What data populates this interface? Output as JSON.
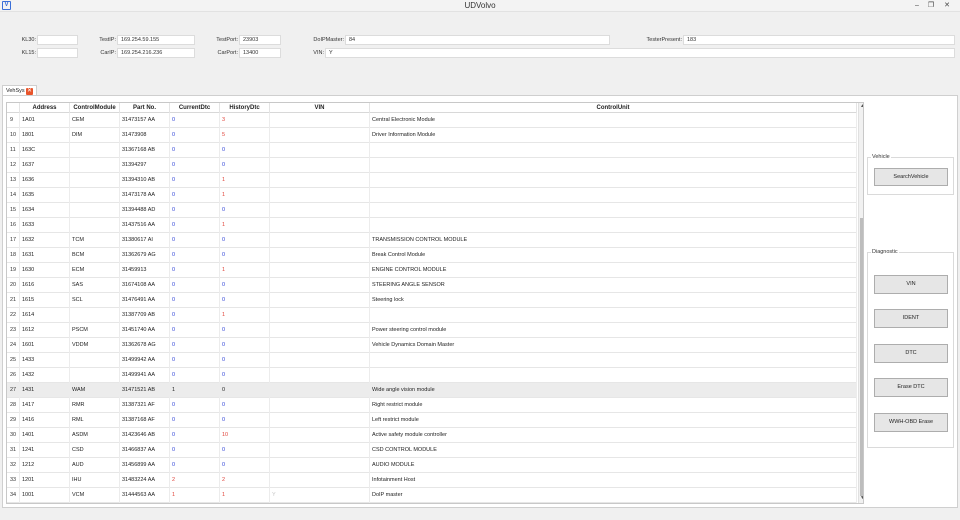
{
  "window": {
    "title": "UDVolvo",
    "app_icon": "V",
    "minimize_glyph": "–",
    "restore_glyph": "❐",
    "close_glyph": "✕"
  },
  "fields": {
    "kl30": {
      "label": "KL30:",
      "value": ""
    },
    "kl15": {
      "label": "KL15:",
      "value": ""
    },
    "test_ip": {
      "label": "TestIP:",
      "value": "169.254.59.155"
    },
    "car_ip": {
      "label": "CarIP:",
      "value": "169.254.216.236"
    },
    "test_port": {
      "label": "TestPort:",
      "value": "23903"
    },
    "car_port": {
      "label": "CarPort:",
      "value": "13400"
    },
    "doip_master": {
      "label": "DoIPMaster:",
      "value": "84"
    },
    "vin": {
      "label": "VIN:",
      "value": "Y"
    },
    "tester_present": {
      "label": "TesterPresent:",
      "value": "183"
    }
  },
  "tab": {
    "label": "VehSys",
    "close_glyph": "✕"
  },
  "grid": {
    "columns": {
      "address": "Address",
      "module": "ControlModule",
      "part": "Part No.",
      "current_dtc": "CurrentDtc",
      "history_dtc": "HistoryDtc",
      "vin": "VIN",
      "unit": "ControlUnit"
    },
    "rows": [
      {
        "n": "9",
        "address": "1A01",
        "module": "CEM",
        "part": "31473157 AA",
        "current": "0",
        "history": "3",
        "vin": "",
        "unit": "Central Electronic Module"
      },
      {
        "n": "10",
        "address": "1801",
        "module": "DIM",
        "part": "31473908",
        "current": "0",
        "history": "5",
        "vin": "",
        "unit": "Driver Information Module"
      },
      {
        "n": "11",
        "address": "163C",
        "module": "",
        "part": "31367168 AB",
        "current": "0",
        "history": "0",
        "vin": "",
        "unit": ""
      },
      {
        "n": "12",
        "address": "1637",
        "module": "",
        "part": "31394297",
        "current": "0",
        "history": "0",
        "vin": "",
        "unit": ""
      },
      {
        "n": "13",
        "address": "1636",
        "module": "",
        "part": "31394310 AB",
        "current": "0",
        "history": "1",
        "vin": "",
        "unit": ""
      },
      {
        "n": "14",
        "address": "1635",
        "module": "",
        "part": "31473178 AA",
        "current": "0",
        "history": "1",
        "vin": "",
        "unit": ""
      },
      {
        "n": "15",
        "address": "1634",
        "module": "",
        "part": "31394488 AD",
        "current": "0",
        "history": "0",
        "vin": "",
        "unit": ""
      },
      {
        "n": "16",
        "address": "1633",
        "module": "",
        "part": "31437516 AA",
        "current": "0",
        "history": "1",
        "vin": "",
        "unit": ""
      },
      {
        "n": "17",
        "address": "1632",
        "module": "TCM",
        "part": "31380617 AI",
        "current": "0",
        "history": "0",
        "vin": "",
        "unit": "TRANSMISSION CONTROL MODULE"
      },
      {
        "n": "18",
        "address": "1631",
        "module": "BCM",
        "part": "31362679 AG",
        "current": "0",
        "history": "0",
        "vin": "",
        "unit": "Break Control Module"
      },
      {
        "n": "19",
        "address": "1630",
        "module": "ECM",
        "part": "31459913",
        "current": "0",
        "history": "1",
        "vin": "",
        "unit": "ENGINE CONTROL MODULE"
      },
      {
        "n": "20",
        "address": "1616",
        "module": "SAS",
        "part": "31674108 AA",
        "current": "0",
        "history": "0",
        "vin": "",
        "unit": "STEERING ANGLE SENSOR"
      },
      {
        "n": "21",
        "address": "1615",
        "module": "SCL",
        "part": "31476491 AA",
        "current": "0",
        "history": "0",
        "vin": "",
        "unit": "Steering lock"
      },
      {
        "n": "22",
        "address": "1614",
        "module": "",
        "part": "31387709 AB",
        "current": "0",
        "history": "1",
        "vin": "",
        "unit": ""
      },
      {
        "n": "23",
        "address": "1612",
        "module": "PSCM",
        "part": "31451740 AA",
        "current": "0",
        "history": "0",
        "vin": "",
        "unit": "Power steering control module"
      },
      {
        "n": "24",
        "address": "1601",
        "module": "VDDM",
        "part": "31362678 AG",
        "current": "0",
        "history": "0",
        "vin": "",
        "unit": "Vehicle Dynamics Domain Master"
      },
      {
        "n": "25",
        "address": "1433",
        "module": "",
        "part": "31499942 AA",
        "current": "0",
        "history": "0",
        "vin": "",
        "unit": ""
      },
      {
        "n": "26",
        "address": "1432",
        "module": "",
        "part": "31499941 AA",
        "current": "0",
        "history": "0",
        "vin": "",
        "unit": ""
      },
      {
        "n": "27",
        "address": "1431",
        "module": "WAM",
        "part": "31471521 AB",
        "current": "1",
        "history": "0",
        "vin": "",
        "unit": "Wide angle vision module",
        "selected": true
      },
      {
        "n": "28",
        "address": "1417",
        "module": "RMR",
        "part": "31387321 AF",
        "current": "0",
        "history": "0",
        "vin": "",
        "unit": "Right restrict module"
      },
      {
        "n": "29",
        "address": "1416",
        "module": "RML",
        "part": "31387168 AF",
        "current": "0",
        "history": "0",
        "vin": "",
        "unit": "Left restrict module"
      },
      {
        "n": "30",
        "address": "1401",
        "module": "ASDM",
        "part": "31423646 AB",
        "current": "0",
        "history": "10",
        "vin": "",
        "unit": "Active safety module controller"
      },
      {
        "n": "31",
        "address": "1241",
        "module": "CSD",
        "part": "31466837 AA",
        "current": "0",
        "history": "0",
        "vin": "",
        "unit": "CSD CONTROL MODULE"
      },
      {
        "n": "32",
        "address": "1212",
        "module": "AUD",
        "part": "31456899 AA",
        "current": "0",
        "history": "0",
        "vin": "",
        "unit": "AUDIO MODULE"
      },
      {
        "n": "33",
        "address": "1201",
        "module": "IHU",
        "part": "31483224 AA",
        "current": "2",
        "history": "2",
        "vin": "",
        "unit": "Infotainment Host"
      },
      {
        "n": "34",
        "address": "1001",
        "module": "VCM",
        "part": "31444563 AA",
        "current": "1",
        "history": "1",
        "vin": "Y",
        "unit": "DoIP master"
      }
    ]
  },
  "scrollbar": {
    "up_glyph": "▲",
    "down_glyph": "▼"
  },
  "vehicle_group": {
    "title": "Vehicle",
    "search_button": "SearchVehicle"
  },
  "diagnostic_group": {
    "title": "Diagnostic",
    "buttons": [
      "VIN",
      "IDENT",
      "DTC",
      "Erase DTC",
      "WWH-OBD Erase"
    ]
  },
  "colors": {
    "zero": "#2b3fd6",
    "nonzero": "#e0443b",
    "selected_row": "#ececec",
    "tab_close": "#e8542a"
  }
}
